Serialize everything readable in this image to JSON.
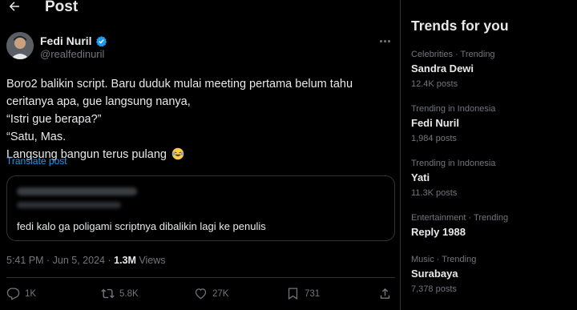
{
  "header": {
    "title": "Post"
  },
  "post": {
    "author_name": "Fedi Nuril",
    "author_handle": "@realfedinuril",
    "text_lines": [
      "Boro2 balikin script. Baru duduk mulai meeting pertama belum tahu",
      "ceritanya apa, gue langsung nanya,",
      "“Istri gue berapa?”",
      "“Satu, Mas.",
      "Langsung bangun terus pulang"
    ],
    "translate_label": "Translate post",
    "quote_text": "fedi kalo ga poligami scriptnya dibalikin lagi ke penulis",
    "timestamp": "5:41 PM · Jun 5, 2024 ·",
    "views_count": "1.3M",
    "views_label": "Views",
    "actions": {
      "replies": "1K",
      "reposts": "5.8K",
      "likes": "27K",
      "bookmarks": "731"
    }
  },
  "trends": {
    "title": "Trends for you",
    "items": [
      {
        "context": "Celebrities · Trending",
        "name": "Sandra Dewi",
        "count": "12.4K posts"
      },
      {
        "context": "Trending in Indonesia",
        "name": "Fedi Nuril",
        "count": "1,984 posts"
      },
      {
        "context": "Trending in Indonesia",
        "name": "Yati",
        "count": "11.3K posts"
      },
      {
        "context": "Entertainment · Trending",
        "name": "Reply 1988",
        "count": ""
      },
      {
        "context": "Music · Trending",
        "name": "Surabaya",
        "count": "7,378 posts"
      }
    ]
  },
  "colors": {
    "background": "#000000",
    "text": "#e7e9ea",
    "secondary": "#71767b",
    "accent": "#1d9bf0",
    "border": "#2f3336"
  },
  "icons": [
    "back-arrow-icon",
    "verified-badge-icon",
    "more-icon",
    "laughing-emoji-icon",
    "reply-icon",
    "repost-icon",
    "like-icon",
    "bookmark-icon",
    "share-icon"
  ]
}
